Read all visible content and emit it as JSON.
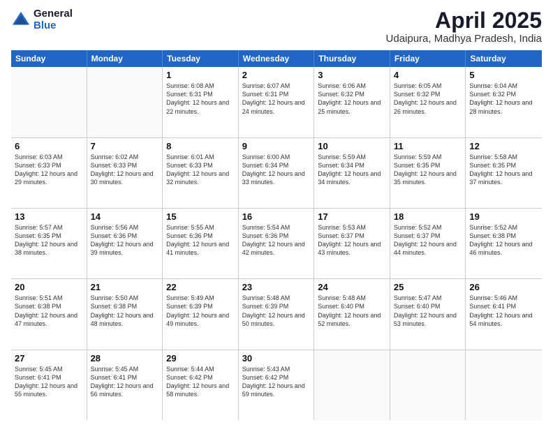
{
  "logo": {
    "general": "General",
    "blue": "Blue"
  },
  "title": {
    "main": "April 2025",
    "sub": "Udaipura, Madhya Pradesh, India"
  },
  "days": [
    "Sunday",
    "Monday",
    "Tuesday",
    "Wednesday",
    "Thursday",
    "Friday",
    "Saturday"
  ],
  "weeks": [
    [
      {
        "day": "",
        "empty": true
      },
      {
        "day": "",
        "empty": true
      },
      {
        "day": "1",
        "rise": "6:08 AM",
        "set": "6:31 PM",
        "daylight": "12 hours and 22 minutes."
      },
      {
        "day": "2",
        "rise": "6:07 AM",
        "set": "6:31 PM",
        "daylight": "12 hours and 24 minutes."
      },
      {
        "day": "3",
        "rise": "6:06 AM",
        "set": "6:32 PM",
        "daylight": "12 hours and 25 minutes."
      },
      {
        "day": "4",
        "rise": "6:05 AM",
        "set": "6:32 PM",
        "daylight": "12 hours and 26 minutes."
      },
      {
        "day": "5",
        "rise": "6:04 AM",
        "set": "6:32 PM",
        "daylight": "12 hours and 28 minutes."
      }
    ],
    [
      {
        "day": "6",
        "rise": "6:03 AM",
        "set": "6:33 PM",
        "daylight": "12 hours and 29 minutes."
      },
      {
        "day": "7",
        "rise": "6:02 AM",
        "set": "6:33 PM",
        "daylight": "12 hours and 30 minutes."
      },
      {
        "day": "8",
        "rise": "6:01 AM",
        "set": "6:33 PM",
        "daylight": "12 hours and 32 minutes."
      },
      {
        "day": "9",
        "rise": "6:00 AM",
        "set": "6:34 PM",
        "daylight": "12 hours and 33 minutes."
      },
      {
        "day": "10",
        "rise": "5:59 AM",
        "set": "6:34 PM",
        "daylight": "12 hours and 34 minutes."
      },
      {
        "day": "11",
        "rise": "5:59 AM",
        "set": "6:35 PM",
        "daylight": "12 hours and 35 minutes."
      },
      {
        "day": "12",
        "rise": "5:58 AM",
        "set": "6:35 PM",
        "daylight": "12 hours and 37 minutes."
      }
    ],
    [
      {
        "day": "13",
        "rise": "5:57 AM",
        "set": "6:35 PM",
        "daylight": "12 hours and 38 minutes."
      },
      {
        "day": "14",
        "rise": "5:56 AM",
        "set": "6:36 PM",
        "daylight": "12 hours and 39 minutes."
      },
      {
        "day": "15",
        "rise": "5:55 AM",
        "set": "6:36 PM",
        "daylight": "12 hours and 41 minutes."
      },
      {
        "day": "16",
        "rise": "5:54 AM",
        "set": "6:36 PM",
        "daylight": "12 hours and 42 minutes."
      },
      {
        "day": "17",
        "rise": "5:53 AM",
        "set": "6:37 PM",
        "daylight": "12 hours and 43 minutes."
      },
      {
        "day": "18",
        "rise": "5:52 AM",
        "set": "6:37 PM",
        "daylight": "12 hours and 44 minutes."
      },
      {
        "day": "19",
        "rise": "5:52 AM",
        "set": "6:38 PM",
        "daylight": "12 hours and 46 minutes."
      }
    ],
    [
      {
        "day": "20",
        "rise": "5:51 AM",
        "set": "6:38 PM",
        "daylight": "12 hours and 47 minutes."
      },
      {
        "day": "21",
        "rise": "5:50 AM",
        "set": "6:38 PM",
        "daylight": "12 hours and 48 minutes."
      },
      {
        "day": "22",
        "rise": "5:49 AM",
        "set": "6:39 PM",
        "daylight": "12 hours and 49 minutes."
      },
      {
        "day": "23",
        "rise": "5:48 AM",
        "set": "6:39 PM",
        "daylight": "12 hours and 50 minutes."
      },
      {
        "day": "24",
        "rise": "5:48 AM",
        "set": "6:40 PM",
        "daylight": "12 hours and 52 minutes."
      },
      {
        "day": "25",
        "rise": "5:47 AM",
        "set": "6:40 PM",
        "daylight": "12 hours and 53 minutes."
      },
      {
        "day": "26",
        "rise": "5:46 AM",
        "set": "6:41 PM",
        "daylight": "12 hours and 54 minutes."
      }
    ],
    [
      {
        "day": "27",
        "rise": "5:45 AM",
        "set": "6:41 PM",
        "daylight": "12 hours and 55 minutes."
      },
      {
        "day": "28",
        "rise": "5:45 AM",
        "set": "6:41 PM",
        "daylight": "12 hours and 56 minutes."
      },
      {
        "day": "29",
        "rise": "5:44 AM",
        "set": "6:42 PM",
        "daylight": "12 hours and 58 minutes."
      },
      {
        "day": "30",
        "rise": "5:43 AM",
        "set": "6:42 PM",
        "daylight": "12 hours and 59 minutes."
      },
      {
        "day": "",
        "empty": true
      },
      {
        "day": "",
        "empty": true
      },
      {
        "day": "",
        "empty": true
      }
    ]
  ],
  "labels": {
    "sunrise": "Sunrise:",
    "sunset": "Sunset:",
    "daylight": "Daylight:"
  }
}
